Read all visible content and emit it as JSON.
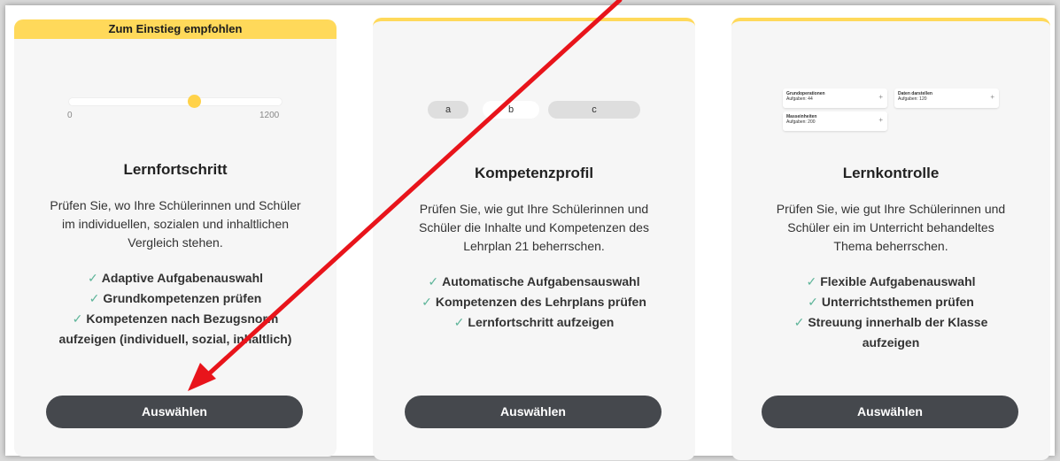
{
  "cards": [
    {
      "banner": "Zum Einstieg empfohlen",
      "slider": {
        "min": "0",
        "max": "1200"
      },
      "title": "Lernfortschritt",
      "description": [
        "Prüfen Sie, wo Ihre Schülerinnen und Schüler",
        "im individuellen, sozialen und inhaltlichen",
        "Vergleich stehen."
      ],
      "features": [
        "Adaptive Aufgabenauswahl",
        "Grundkompetenzen prüfen",
        "Kompetenzen nach Bezugsnorm",
        "aufzeigen (individuell, sozial, inhaltlich)"
      ],
      "button": "Auswählen"
    },
    {
      "segments": [
        "a",
        "b",
        "c"
      ],
      "title": "Kompetenzprofil",
      "description": [
        "Prüfen Sie, wie gut Ihre Schülerinnen und",
        "Schüler die Inhalte und Kompetenzen des",
        "Lehrplan 21 beherrschen."
      ],
      "features": [
        "Automatische Aufgabensauswahl",
        "Kompetenzen des Lehrplans prüfen",
        "Lernfortschritt aufzeigen"
      ],
      "button": "Auswählen"
    },
    {
      "mini": [
        {
          "name": "Grundoperationen",
          "count": "Aufgaben: 44"
        },
        {
          "name": "Daten darstellen",
          "count": "Aufgaben: 120"
        },
        {
          "name": "Masseinheiten",
          "count": "Aufgaben: 200"
        }
      ],
      "title": "Lernkontrolle",
      "description": [
        "Prüfen Sie, wie gut Ihre Schülerinnen und",
        "Schüler ein im Unterricht behandeltes",
        "Thema beherrschen."
      ],
      "features": [
        "Flexible Aufgabenauswahl",
        "Unterrichtsthemen prüfen",
        "Streuung innerhalb der Klasse",
        "aufzeigen"
      ],
      "button": "Auswählen"
    }
  ],
  "colors": {
    "accent": "#ffd95a",
    "button": "#45484d",
    "check": "#5fb59a",
    "arrow": "#e8141b"
  }
}
